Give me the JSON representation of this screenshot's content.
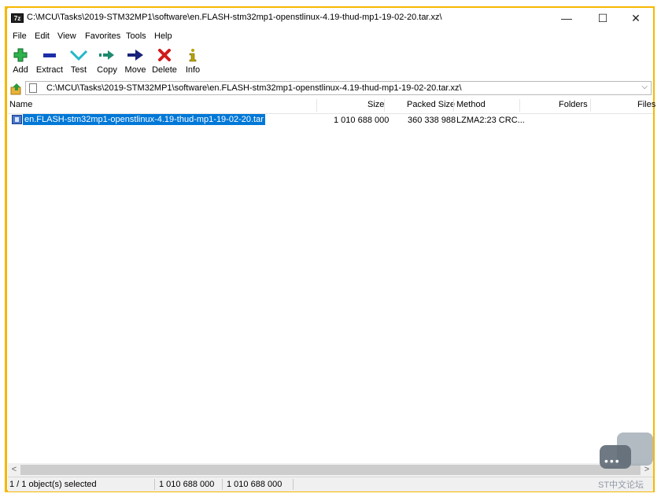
{
  "window": {
    "title": "C:\\MCU\\Tasks\\2019-STM32MP1\\software\\en.FLASH-stm32mp1-openstlinux-4.19-thud-mp1-19-02-20.tar.xz\\",
    "app_icon_text": "7z",
    "minimize": "—",
    "maximize": "☐",
    "close": "✕"
  },
  "menu": [
    "File",
    "Edit",
    "View",
    "Favorites",
    "Tools",
    "Help"
  ],
  "toolbar": [
    {
      "label": "Add",
      "icon": "plus-icon",
      "color": "#2fb24c"
    },
    {
      "label": "Extract",
      "icon": "minus-icon",
      "color": "#1c2ea8"
    },
    {
      "label": "Test",
      "icon": "check-chevron-icon",
      "color": "#23b7c9"
    },
    {
      "label": "Copy",
      "icon": "double-arrow-icon",
      "color": "#1f8a6e"
    },
    {
      "label": "Move",
      "icon": "arrow-right-icon",
      "color": "#18227a"
    },
    {
      "label": "Delete",
      "icon": "x-icon",
      "color": "#d01b1b"
    },
    {
      "label": "Info",
      "icon": "info-icon",
      "color": "#b8a200"
    }
  ],
  "address": {
    "path": "C:\\MCU\\Tasks\\2019-STM32MP1\\software\\en.FLASH-stm32mp1-openstlinux-4.19-thud-mp1-19-02-20.tar.xz\\",
    "dropdown": "⌵"
  },
  "columns": {
    "name": "Name",
    "size": "Size",
    "packed_size": "Packed Size",
    "method": "Method",
    "folders": "Folders",
    "files": "Files"
  },
  "rows": [
    {
      "name": "en.FLASH-stm32mp1-openstlinux-4.19-thud-mp1-19-02-20.tar",
      "size": "1 010 688 000",
      "packed_size": "360 338 988",
      "method": "LZMA2:23 CRC...",
      "folders": "",
      "files": ""
    }
  ],
  "status": {
    "selection": "1 / 1 object(s) selected",
    "size": "1 010 688 000",
    "packed": "1 010 688 000"
  },
  "scroll": {
    "left": "<",
    "right": ">"
  },
  "watermark": {
    "text": "ST中文论坛",
    "dots": "•••"
  },
  "colors": {
    "selection": "#0078d7",
    "frame": "#f5b800"
  }
}
